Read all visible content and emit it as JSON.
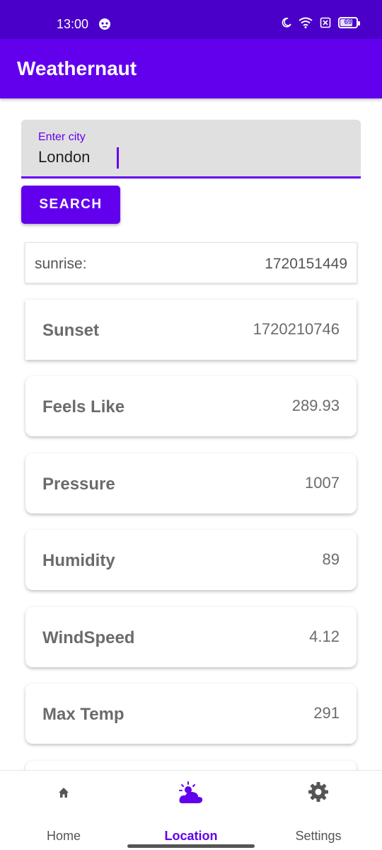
{
  "status_bar": {
    "time": "13:00",
    "battery": "69"
  },
  "app_bar": {
    "title": "Weathernaut"
  },
  "search": {
    "label": "Enter city",
    "value": "London",
    "button_label": "SEARCH"
  },
  "sunrise": {
    "label": "sunrise:",
    "value": "1720151449"
  },
  "cards": [
    {
      "label": "Sunset",
      "value": "1720210746"
    },
    {
      "label": "Feels Like",
      "value": "289.93"
    },
    {
      "label": "Pressure",
      "value": "1007"
    },
    {
      "label": "Humidity",
      "value": "89"
    },
    {
      "label": "WindSpeed",
      "value": "4.12"
    },
    {
      "label": "Max Temp",
      "value": "291"
    }
  ],
  "bottom_nav": {
    "items": [
      {
        "label": "Home",
        "icon": "home-icon"
      },
      {
        "label": "Location",
        "icon": "cloud-sun-icon"
      },
      {
        "label": "Settings",
        "icon": "gear-icon"
      }
    ],
    "active": "Location"
  },
  "colors": {
    "primary": "#6200ee",
    "status_bar": "#4a00c8"
  }
}
